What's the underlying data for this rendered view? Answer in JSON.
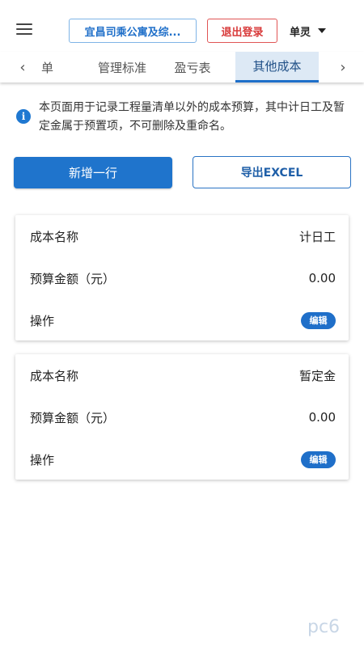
{
  "header": {
    "menu_icon": "hamburger-icon",
    "project_label": "宜昌司乘公寓及综...",
    "logout_label": "退出登录",
    "user_name": "单灵",
    "user_caret_icon": "caret-down-icon"
  },
  "tabs": {
    "prev_icon": "chevron-left-icon",
    "next_icon": "chevron-right-icon",
    "items": [
      {
        "label": "单"
      },
      {
        "label": "管理标准"
      },
      {
        "label": "盈亏表"
      },
      {
        "label": "其他成本",
        "active": true
      }
    ]
  },
  "info": {
    "icon": "info-icon",
    "text": "本页面用于记录工程量清单以外的成本预算，其中计日工及暂定金属于预置项，不可删除及重命名。"
  },
  "actions": {
    "add_label": "新增一行",
    "export_label": "导出EXCEL"
  },
  "cards": [
    {
      "name_label": "成本名称",
      "name_value": "计日工",
      "amount_label": "预算金额（元）",
      "amount_value": "0.00",
      "op_label": "操作",
      "edit_label": "编辑"
    },
    {
      "name_label": "成本名称",
      "name_value": "暂定金",
      "amount_label": "预算金额（元）",
      "amount_value": "0.00",
      "op_label": "操作",
      "edit_label": "编辑"
    }
  ],
  "watermark": "pc6"
}
